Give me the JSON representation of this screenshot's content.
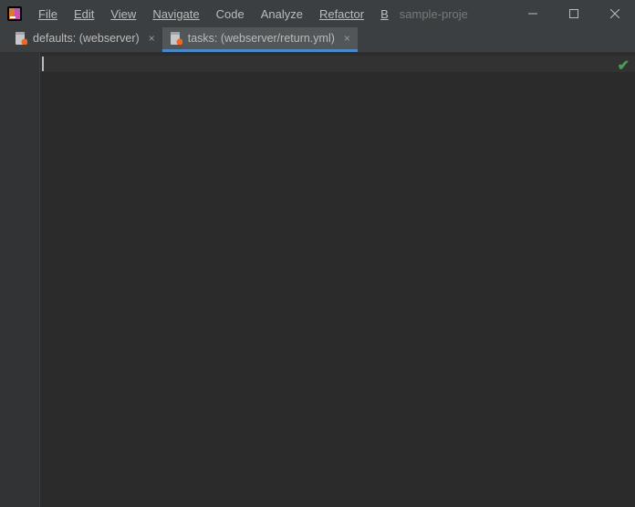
{
  "menu": {
    "file": "File",
    "edit": "Edit",
    "view": "View",
    "navigate": "Navigate",
    "code": "Code",
    "analyze": "Analyze",
    "refactor": "Refactor",
    "build": "B"
  },
  "projectName": "sample-proje",
  "tabs": [
    {
      "label": "defaults: (webserver)",
      "active": false
    },
    {
      "label": "tasks: (webserver/return.yml)",
      "active": true
    }
  ]
}
